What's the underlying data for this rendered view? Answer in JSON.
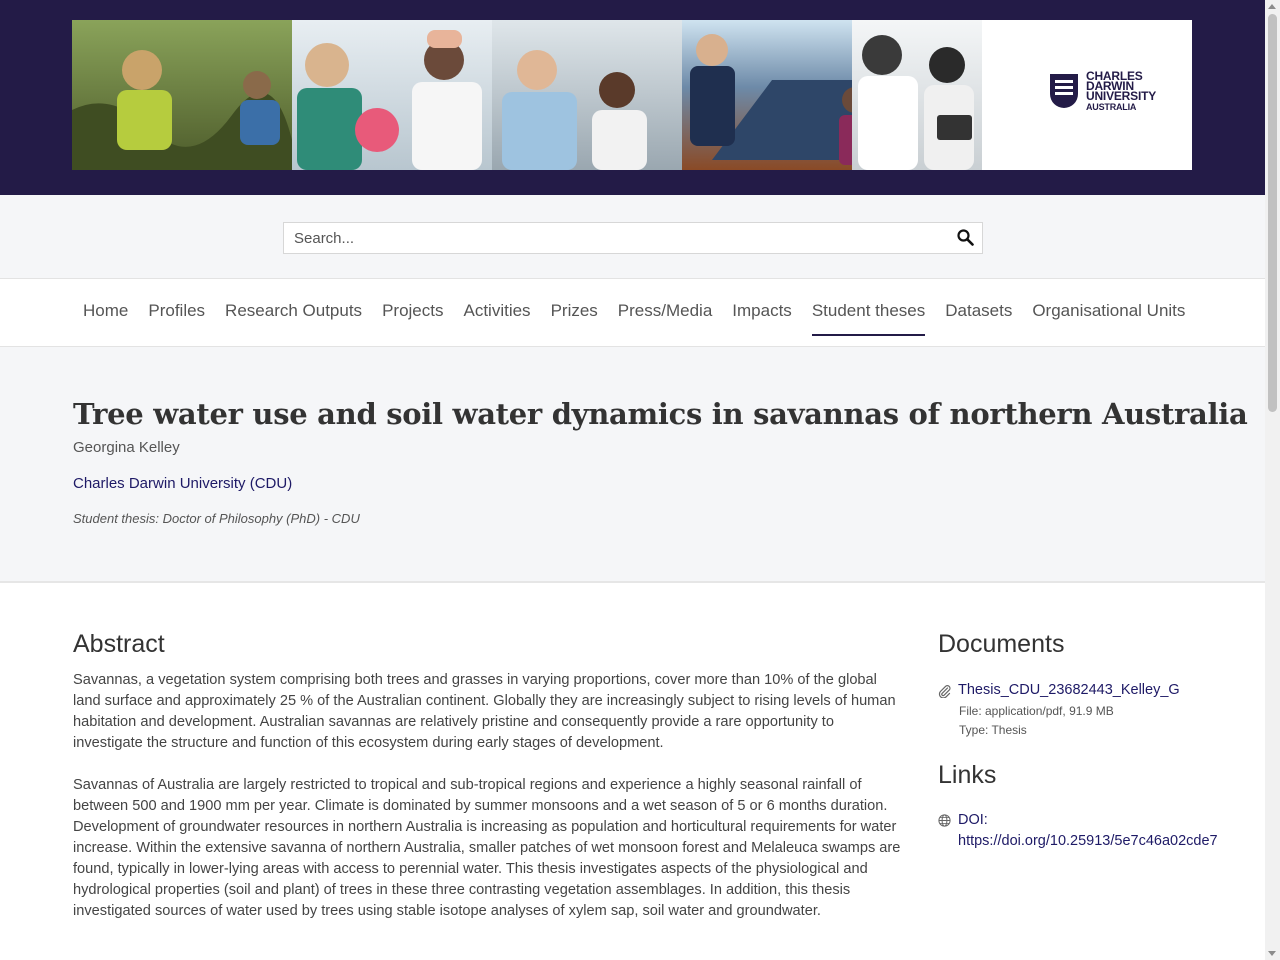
{
  "banner": {
    "logo_line1": "CHARLES",
    "logo_line2": "DARWIN",
    "logo_line3": "UNIVERSITY",
    "logo_line4": "AUSTRALIA",
    "brand_color": "#231b47"
  },
  "search": {
    "placeholder": "Search...",
    "value": "",
    "icon": "search-icon"
  },
  "nav": {
    "items": [
      {
        "label": "Home",
        "active": false
      },
      {
        "label": "Profiles",
        "active": false
      },
      {
        "label": "Research Outputs",
        "active": false
      },
      {
        "label": "Projects",
        "active": false
      },
      {
        "label": "Activities",
        "active": false
      },
      {
        "label": "Prizes",
        "active": false
      },
      {
        "label": "Press/Media",
        "active": false
      },
      {
        "label": "Impacts",
        "active": false
      },
      {
        "label": "Student theses",
        "active": true
      },
      {
        "label": "Datasets",
        "active": false
      },
      {
        "label": "Organisational Units",
        "active": false
      }
    ]
  },
  "thesis": {
    "title": "Tree water use and soil water dynamics in savannas of northern Australia",
    "author": "Georgina Kelley",
    "organisation": "Charles Darwin University (CDU)",
    "type": "Student thesis: Doctor of Philosophy (PhD) - CDU"
  },
  "abstract": {
    "heading": "Abstract",
    "paragraphs": [
      "Savannas, a vegetation system comprising both trees and grasses in varying proportions, cover more than 10% of the global land surface and approximately 25 % of the Australian continent. Globally they are increasingly subject to rising levels of human habitation and development. Australian savannas are relatively pristine and consequently provide a rare opportunity to investigate the structure and function of this ecosystem during early stages of development.",
      "Savannas of Australia are largely restricted to tropical and sub-tropical regions and experience a highly seasonal rainfall of between 500 and 1900 mm per year. Climate is dominated by summer monsoons and a wet season of 5 or 6 months duration. Development of groundwater resources in northern Australia is increasing as population and horticultural requirements for water increase. Within the extensive savanna of northern Australia, smaller patches of wet monsoon forest and Melaleuca swamps are found, typically in lower-lying areas with access to perennial water. This thesis investigates aspects of the physiological and hydrological properties (soil and plant) of trees in these three contrasting vegetation assemblages. In addition, this thesis investigated sources of water used by trees using stable isotope analyses of xylem sap, soil water and groundwater."
    ]
  },
  "documents": {
    "heading": "Documents",
    "file_name": "Thesis_CDU_23682443_Kelley_G",
    "file_meta": "File: application/pdf, 91.9 MB",
    "file_type": "Type: Thesis",
    "icon": "paperclip-icon"
  },
  "links": {
    "heading": "Links",
    "doi_label": "DOI:",
    "doi_url": "https://doi.org/10.25913/5e7c46a02cde7",
    "icon": "globe-icon"
  },
  "colors": {
    "accent": "#231b47",
    "link": "#1e1a66",
    "section_bg": "#f5f6f8"
  }
}
